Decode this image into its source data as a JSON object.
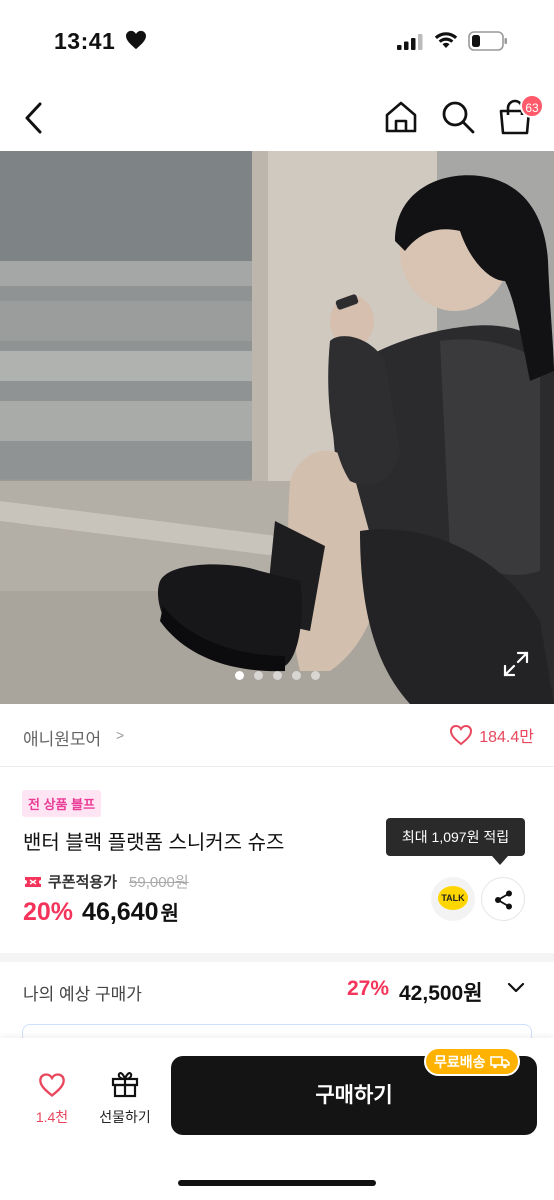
{
  "status_bar": {
    "time": "13:41"
  },
  "nav": {
    "cart_count": "63"
  },
  "hero": {
    "slide_count": 5,
    "active_slide": 1
  },
  "brand": {
    "name": "애니원모어",
    "chevron": ">",
    "like_count": "184.4만"
  },
  "product": {
    "promo_tag": "전 상품 블프",
    "name": "밴터 블랙 플랫폼 스니커즈 슈즈",
    "coupon_label": "쿠폰적용가",
    "original_price": "59,000원",
    "discount": "20%",
    "price": "46,640",
    "currency": "원",
    "points_tooltip": "최대 1,097원 적립",
    "talk_label": "TALK"
  },
  "expected_price": {
    "label": "나의 예상 구매가",
    "discount": "27%",
    "price": "42,500원"
  },
  "bottom_bar": {
    "like_count": "1.4천",
    "gift_label": "선물하기",
    "buy_label": "구매하기",
    "shipping_badge": "무료배송"
  },
  "colors": {
    "accent_red": "#f4345a",
    "like_red": "#e8475d",
    "promo_pink": "#ea3c96",
    "ship_badge": "#ffb300",
    "buy_button": "#141414"
  }
}
